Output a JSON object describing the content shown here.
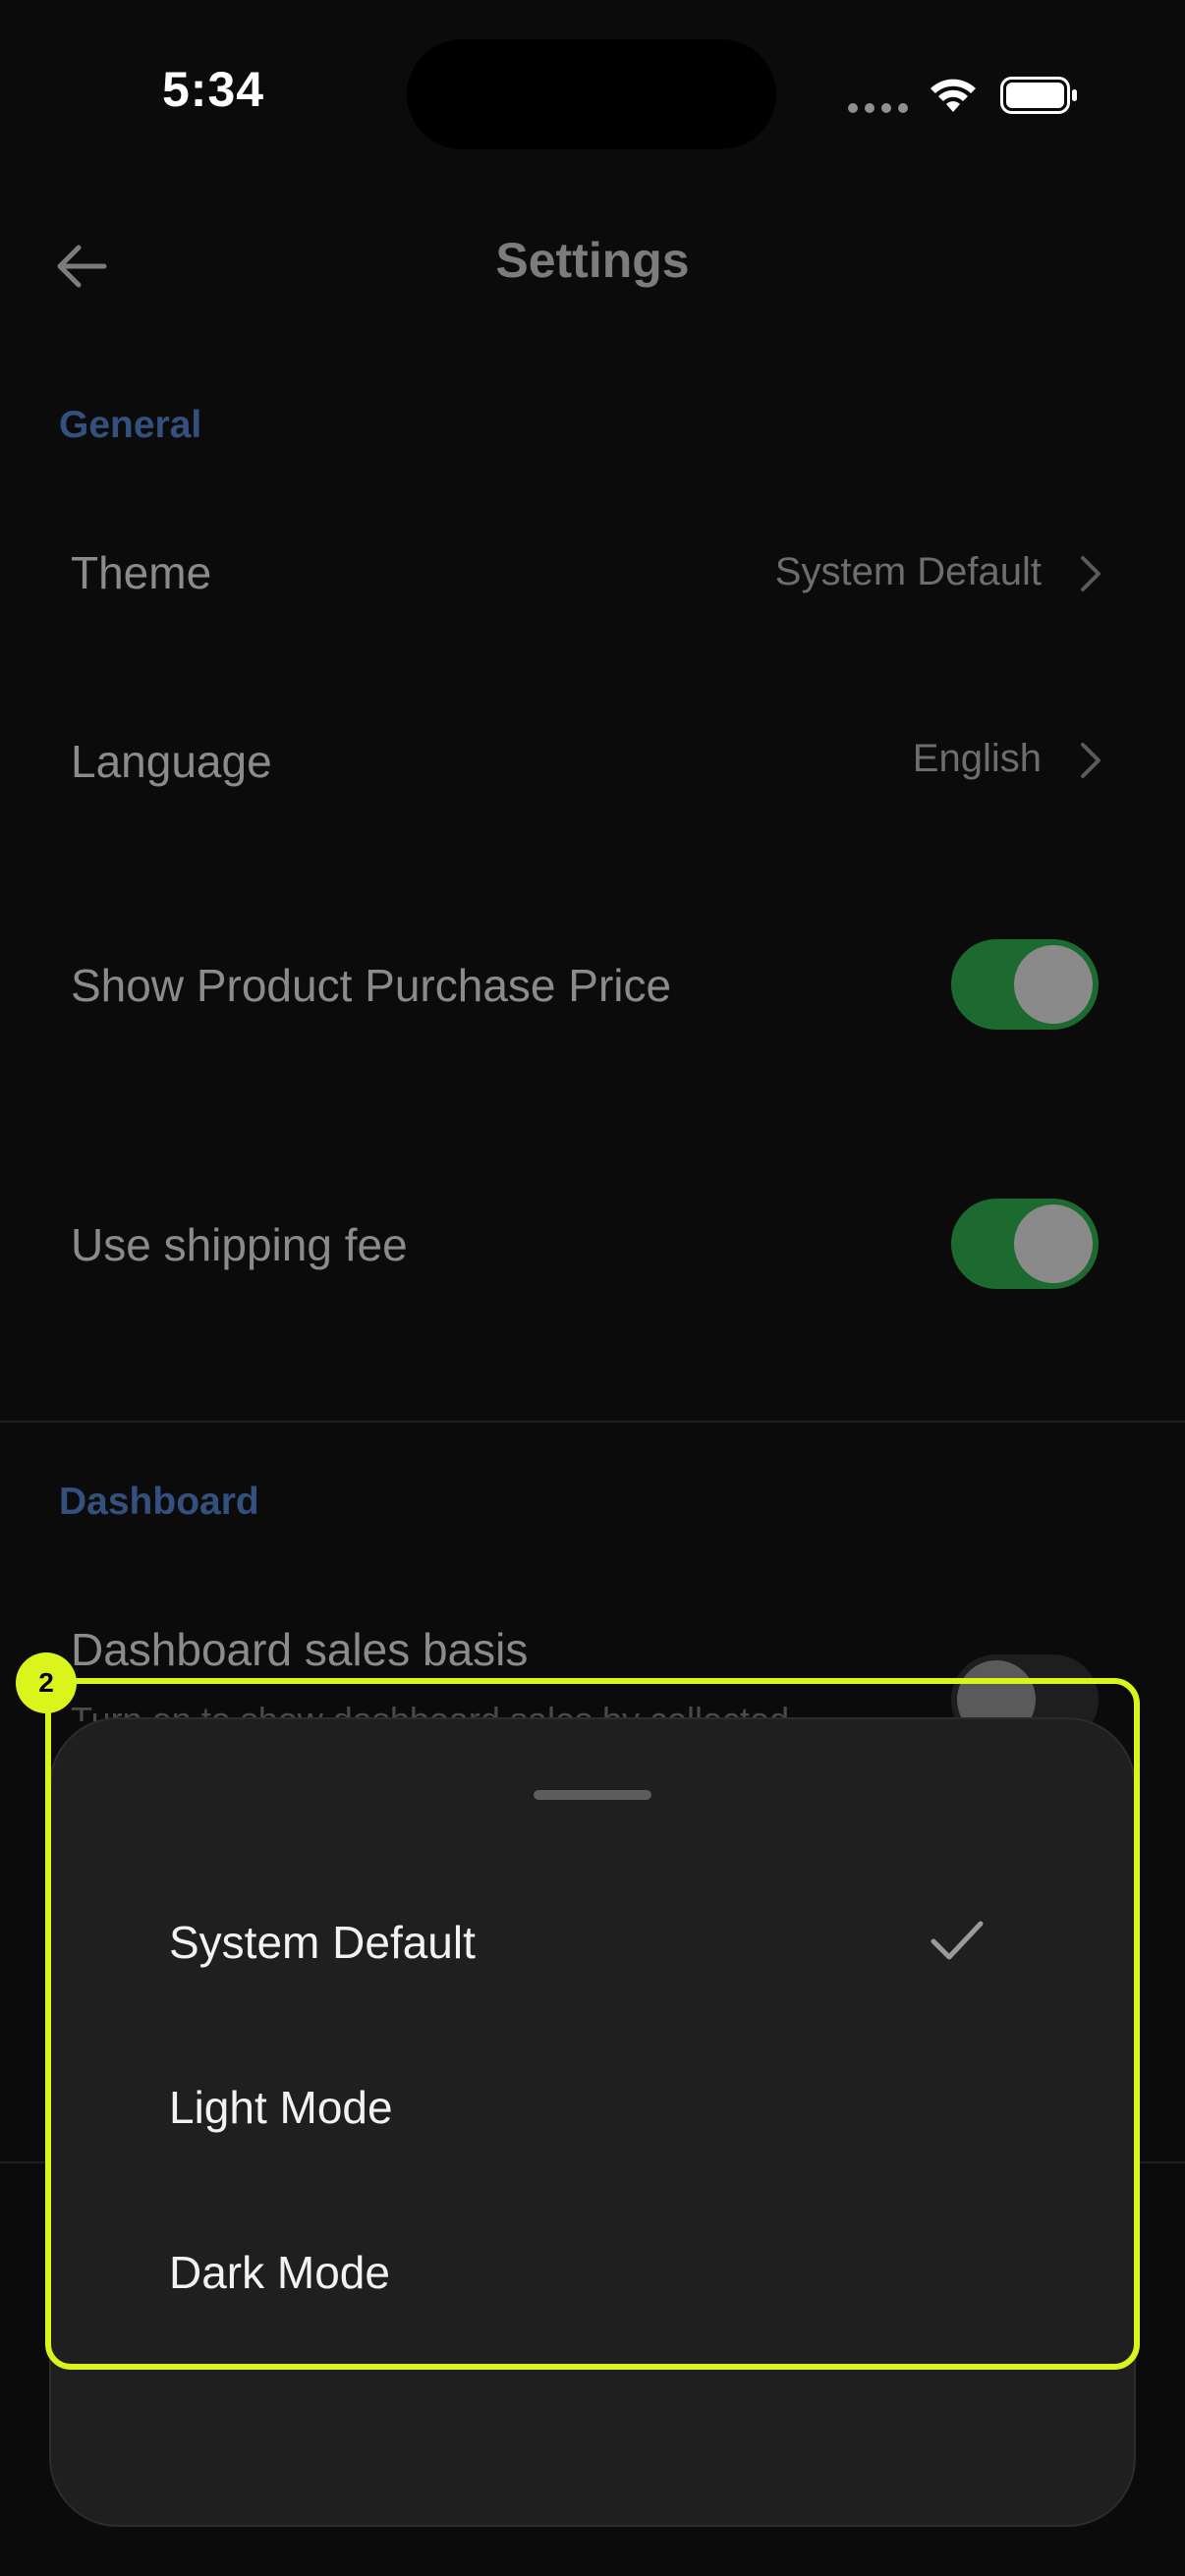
{
  "status_bar": {
    "time": "5:34"
  },
  "header": {
    "title": "Settings"
  },
  "general": {
    "section_title": "General",
    "theme_label": "Theme",
    "theme_value": "System Default",
    "language_label": "Language",
    "language_value": "English",
    "purchase_price_label": "Show Product Purchase Price",
    "purchase_price_on": true,
    "shipping_fee_label": "Use shipping fee",
    "shipping_fee_on": true
  },
  "dashboard": {
    "section_title": "Dashboard",
    "sales_basis_label": "Dashboard sales basis",
    "sales_basis_subtext": "Turn on to show dashboard sales by collected",
    "sales_basis_on": false
  },
  "theme_sheet": {
    "options": [
      "System Default",
      "Light Mode",
      "Dark Mode"
    ],
    "selected": "System Default"
  },
  "overlay": {
    "badge": "2",
    "highlight_color": "#d9f51b"
  },
  "colors": {
    "toggle_on": "#1c6a30",
    "section_title": "#34507f",
    "background": "#0b0b0b",
    "sheet": "#1f1f1f"
  }
}
